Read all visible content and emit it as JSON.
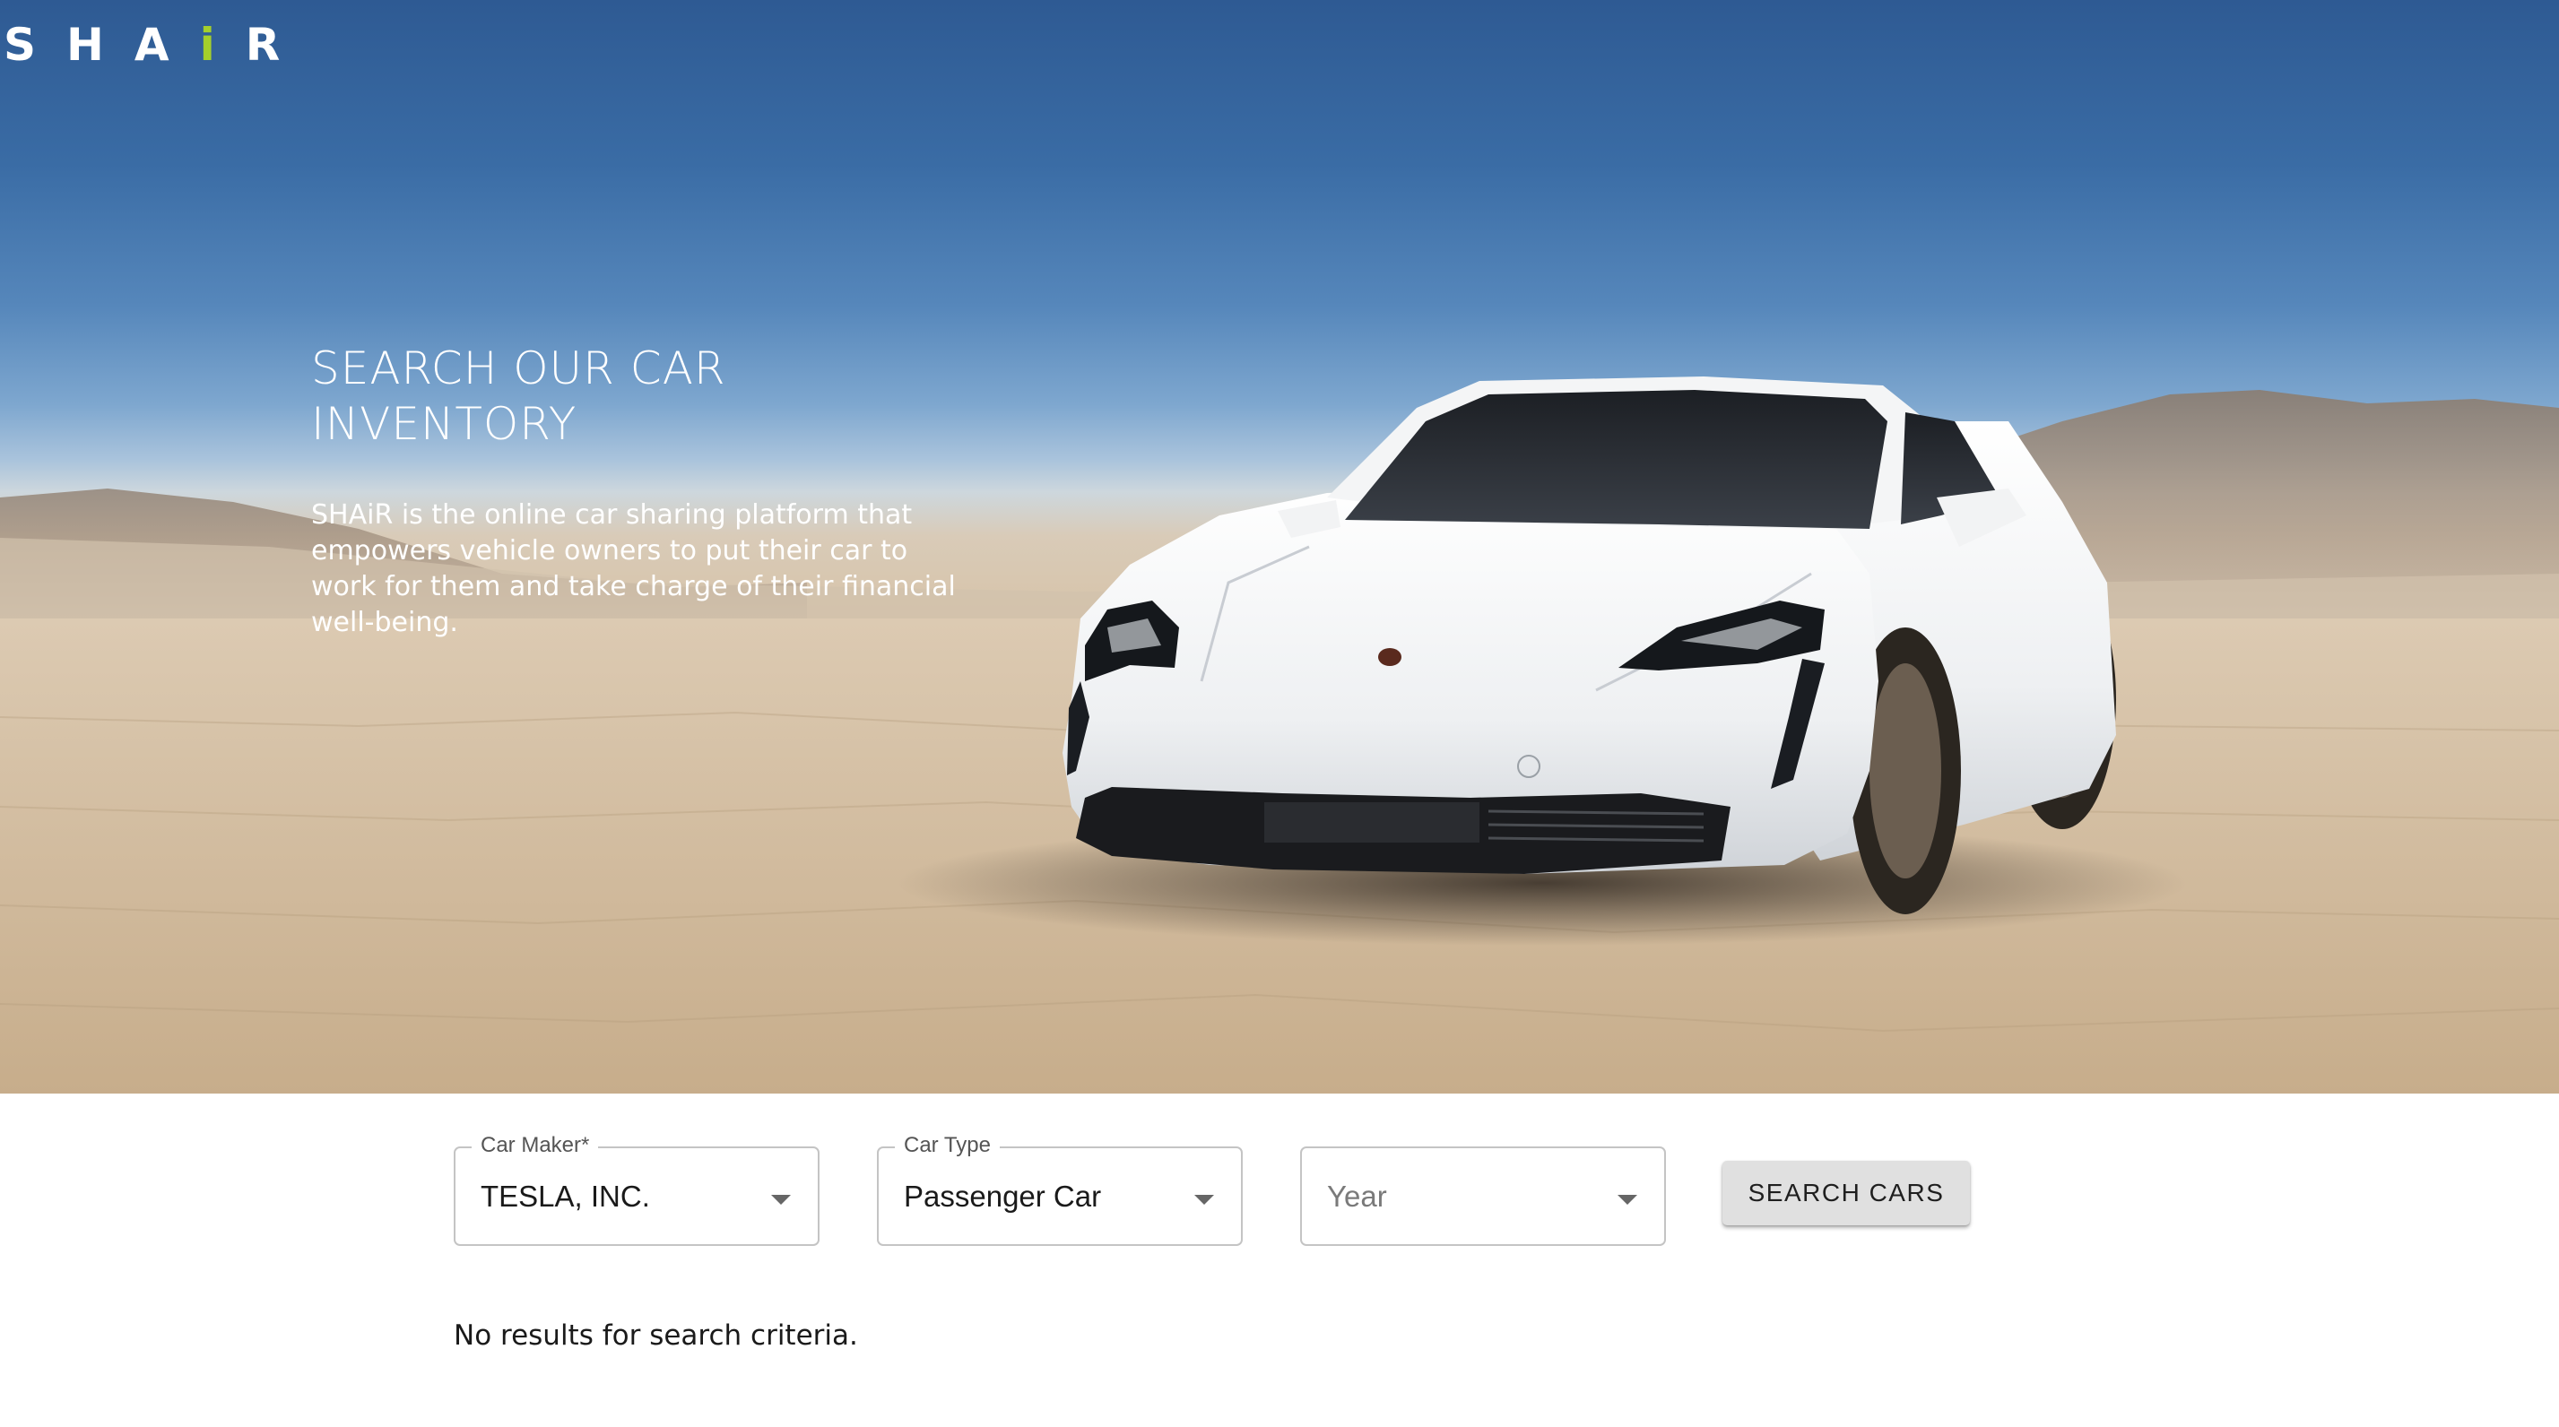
{
  "brand": {
    "logo_prefix": "SHA",
    "logo_accent": "i",
    "logo_suffix": "R",
    "accent_color": "#a4cf2c"
  },
  "hero": {
    "title": "SEARCH OUR CAR INVENTORY",
    "description": "SHAiR is the online car sharing platform that empowers vehicle owners to put their car to work for them and take charge of their financial well-being.",
    "image": "white sports sedan in desert"
  },
  "search": {
    "car_maker": {
      "label": "Car Maker",
      "required_marker": "*",
      "value": "TESLA, INC."
    },
    "car_type": {
      "label": "Car Type",
      "value": "Passenger Car"
    },
    "year": {
      "placeholder": "Year"
    },
    "button_label": "SEARCH CARS"
  },
  "results": {
    "message": "No results for search criteria."
  }
}
